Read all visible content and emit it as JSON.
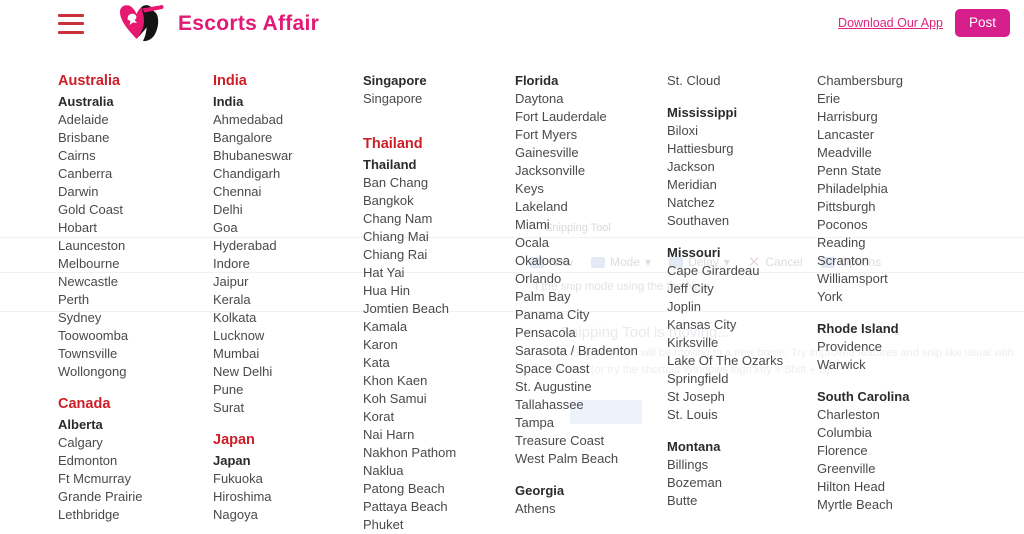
{
  "header": {
    "menu_icon": "hamburger-menu-icon",
    "logo_icon": "heart-woman-graduate-logo-icon",
    "brand": "Escorts Affair",
    "app_link": "Download Our App",
    "post_button": "Post",
    "accent_pink": "#d61e8c",
    "accent_red": "#cc1f28"
  },
  "ghost_overlay": {
    "title": "Snipping Tool",
    "toolbar": [
      "New",
      "Mode",
      "Delay",
      "Cancel",
      "Options"
    ],
    "hint": "t the snip mode using the                    the New",
    "notice_title": "Snipping Tool is moving...",
    "notice_body": "late, Snipping Tool will be moving to a new home. Try improved features and snip like usual with Sni etch (or try the shortcut Windows logo key + Shift + S)."
  },
  "columns": [
    {
      "name": "column-1",
      "groups": [
        {
          "country": "Australia",
          "region": "Australia",
          "cities": [
            "Adelaide",
            "Brisbane",
            "Cairns",
            "Canberra",
            "Darwin",
            "Gold Coast",
            "Hobart",
            "Launceston",
            "Melbourne",
            "Newcastle",
            "Perth",
            "Sydney",
            "Toowoomba",
            "Townsville",
            "Wollongong"
          ]
        },
        {
          "country": "Canada",
          "region": "Alberta",
          "cities": [
            "Calgary",
            "Edmonton",
            "Ft Mcmurray",
            "Grande Prairie",
            "Lethbridge"
          ]
        }
      ]
    },
    {
      "name": "column-2",
      "groups": [
        {
          "country": "India",
          "region": "India",
          "cities": [
            "Ahmedabad",
            "Bangalore",
            "Bhubaneswar",
            "Chandigarh",
            "Chennai",
            "Delhi",
            "Goa",
            "Hyderabad",
            "Indore",
            "Jaipur",
            "Kerala",
            "Kolkata",
            "Lucknow",
            "Mumbai",
            "New Delhi",
            "Pune",
            "Surat"
          ]
        },
        {
          "country": "Japan",
          "region": "Japan",
          "cities": [
            "Fukuoka",
            "Hiroshima",
            "Nagoya"
          ]
        }
      ]
    },
    {
      "name": "column-3",
      "groups": [
        {
          "country": "",
          "region": "Singapore",
          "cities": [
            "Singapore"
          ]
        },
        {
          "country": "Thailand",
          "region": "Thailand",
          "cities": [
            "Ban Chang",
            "Bangkok",
            "Chang Nam",
            "Chiang Mai",
            "Chiang Rai",
            "Hat Yai",
            "Hua Hin",
            "Jomtien Beach",
            "Kamala",
            "Karon",
            "Kata",
            "Khon Kaen",
            "Koh Samui",
            "Korat",
            "Nai Harn",
            "Nakhon Pathom",
            "Naklua",
            "Patong Beach",
            "Pattaya Beach",
            "Phuket"
          ]
        }
      ]
    },
    {
      "name": "column-4",
      "groups": [
        {
          "country": "",
          "region": "Florida",
          "cities": [
            "Daytona",
            "Fort Lauderdale",
            "Fort Myers",
            "Gainesville",
            "Jacksonville",
            "Keys",
            "Lakeland",
            "Miami",
            "Ocala",
            "Okaloosa",
            "Orlando",
            "Palm Bay",
            "Panama City",
            "Pensacola",
            "Sarasota / Bradenton",
            "Space Coast",
            "St. Augustine",
            "Tallahassee",
            "Tampa",
            "Treasure Coast",
            "West Palm Beach"
          ]
        },
        {
          "country": "",
          "region": "Georgia",
          "cities": [
            "Athens"
          ]
        }
      ]
    },
    {
      "name": "column-5",
      "groups": [
        {
          "country": "",
          "region": "",
          "cities": [
            "St. Cloud"
          ]
        },
        {
          "country": "",
          "region": "Mississippi",
          "cities": [
            "Biloxi",
            "Hattiesburg",
            "Jackson",
            "Meridian",
            "Natchez",
            "Southaven"
          ]
        },
        {
          "country": "",
          "region": "Missouri",
          "cities": [
            "Cape Girardeau",
            "Jeff City",
            "Joplin",
            "Kansas City",
            "Kirksville",
            "Lake Of The Ozarks",
            "Springfield",
            "St Joseph",
            "St. Louis"
          ]
        },
        {
          "country": "",
          "region": "Montana",
          "cities": [
            "Billings",
            "Bozeman",
            "Butte"
          ]
        }
      ]
    },
    {
      "name": "column-6",
      "groups": [
        {
          "country": "",
          "region": "",
          "cities": [
            "Chambersburg",
            "Erie",
            "Harrisburg",
            "Lancaster",
            "Meadville",
            "Penn State",
            "Philadelphia",
            "Pittsburgh",
            "Poconos",
            "Reading",
            "Scranton",
            "Williamsport",
            "York"
          ]
        },
        {
          "country": "",
          "region": "Rhode Island",
          "cities": [
            "Providence",
            "Warwick"
          ]
        },
        {
          "country": "",
          "region": "South Carolina",
          "cities": [
            "Charleston",
            "Columbia",
            "Florence",
            "Greenville",
            "Hilton Head",
            "Myrtle Beach"
          ]
        }
      ]
    }
  ]
}
